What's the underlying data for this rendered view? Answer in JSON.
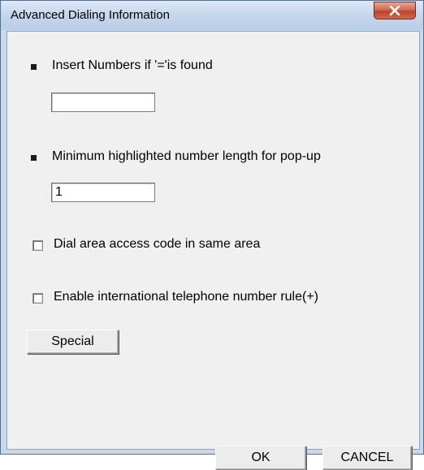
{
  "window": {
    "title": "Advanced Dialing Information",
    "close_icon": "close-icon"
  },
  "form": {
    "insert_numbers": {
      "label": "Insert Numbers if '='is found",
      "value": ""
    },
    "min_length": {
      "label": "Minimum highlighted number length for pop-up",
      "value": "1"
    },
    "dial_area_access": {
      "label": "Dial area access code in same area",
      "checked": false
    },
    "international_rule": {
      "label": "Enable international telephone number rule(+)",
      "checked": false
    }
  },
  "buttons": {
    "special_label": "Special",
    "ok_label": "OK",
    "cancel_label": "CANCEL"
  }
}
